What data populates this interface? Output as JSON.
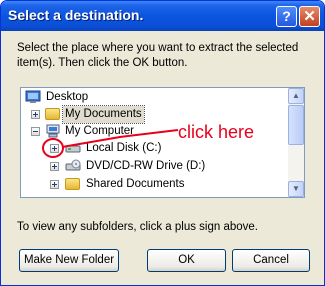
{
  "window": {
    "title": "Select a destination.",
    "help_glyph": "?",
    "close_glyph": "✕"
  },
  "instruction": "Select the place where you want to extract the selected item(s).  Then click the OK button.",
  "tree": {
    "items": [
      {
        "label": "Desktop",
        "icon": "desktop-icon",
        "expander": "none"
      },
      {
        "label": "My Documents",
        "icon": "folder-icon",
        "expander": "plus",
        "selected": true
      },
      {
        "label": "My Computer",
        "icon": "computer-icon",
        "expander": "minus"
      },
      {
        "label": "Local Disk (C:)",
        "icon": "hard-disk-icon",
        "expander": "plus"
      },
      {
        "label": "DVD/CD-RW Drive (D:)",
        "icon": "optical-drive-icon",
        "expander": "plus"
      },
      {
        "label": "Shared Documents",
        "icon": "folder-icon",
        "expander": "plus"
      }
    ]
  },
  "hint": "To view any subfolders, click a plus sign above.",
  "buttons": {
    "new_folder": "Make New Folder",
    "ok": "OK",
    "cancel": "Cancel"
  },
  "annotation": {
    "text": "click here",
    "color": "#e8001c"
  }
}
